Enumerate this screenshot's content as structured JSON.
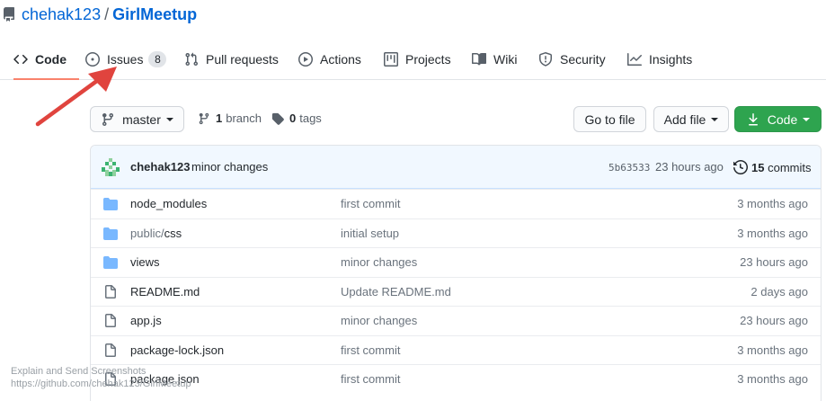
{
  "repo": {
    "owner": "chehak123",
    "separator": "/",
    "name": "GirlMeetup"
  },
  "tabs": [
    {
      "label": "Code",
      "icon": "code-icon",
      "selected": true
    },
    {
      "label": "Issues",
      "icon": "issue-opened-icon",
      "counter": "8"
    },
    {
      "label": "Pull requests",
      "icon": "git-pull-request-icon"
    },
    {
      "label": "Actions",
      "icon": "play-icon"
    },
    {
      "label": "Projects",
      "icon": "project-icon"
    },
    {
      "label": "Wiki",
      "icon": "book-icon"
    },
    {
      "label": "Security",
      "icon": "shield-icon"
    },
    {
      "label": "Insights",
      "icon": "graph-icon"
    }
  ],
  "toolbar": {
    "branch_select": "master",
    "branch_count": "1",
    "branch_word": "branch",
    "tag_count": "0",
    "tag_word": "tags",
    "go_to_file": "Go to file",
    "add_file": "Add file",
    "code_button": "Code"
  },
  "commit": {
    "author": "chehak123",
    "message": "minor changes",
    "sha": "5b63533",
    "time": "23 hours ago",
    "count": "15",
    "count_word": "commits"
  },
  "files": [
    {
      "type": "dir",
      "name": "node_modules",
      "message": "first commit",
      "age": "3 months ago"
    },
    {
      "type": "dir",
      "prefix": "public/",
      "name": "css",
      "message": "initial setup",
      "age": "3 months ago"
    },
    {
      "type": "dir",
      "name": "views",
      "message": "minor changes",
      "age": "23 hours ago"
    },
    {
      "type": "file",
      "name": "README.md",
      "message": "Update README.md",
      "age": "2 days ago"
    },
    {
      "type": "file",
      "name": "app.js",
      "message": "minor changes",
      "age": "23 hours ago"
    },
    {
      "type": "file",
      "name": "package-lock.json",
      "message": "first commit",
      "age": "3 months ago"
    },
    {
      "type": "file",
      "name": "package.json",
      "message": "first commit",
      "age": "3 months ago"
    }
  ],
  "status_overlay": {
    "line1": "Explain and Send Screenshots",
    "line2": "https://github.com/chehak123/GirlMeetup"
  },
  "colors": {
    "link": "#0366d6",
    "selected_tab_underline": "#f9826c",
    "green_button": "#2ea44f",
    "folder_icon": "#79b8ff",
    "annotation_arrow": "#e0443e"
  }
}
